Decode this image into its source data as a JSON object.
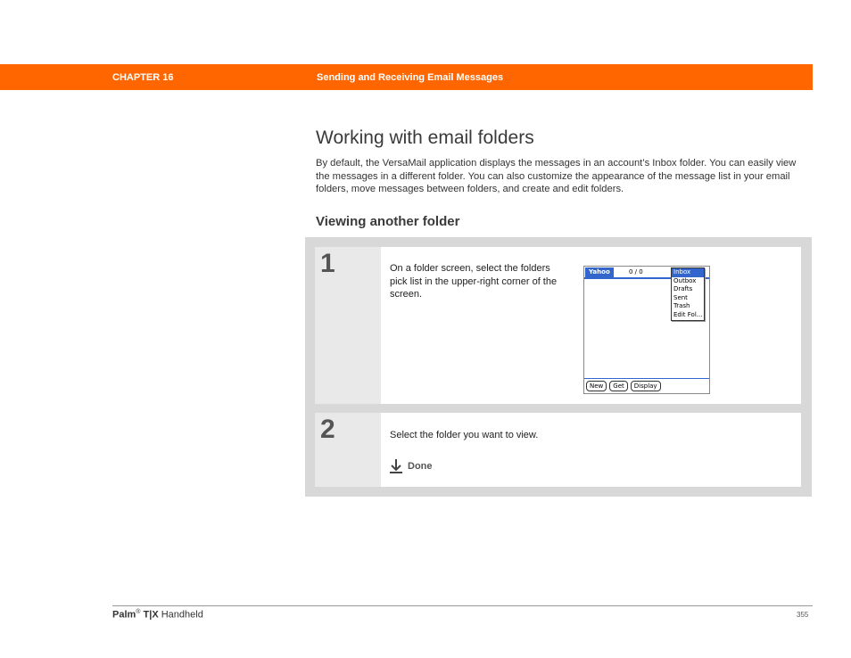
{
  "header": {
    "chapter": "CHAPTER 16",
    "title": "Sending and Receiving Email Messages",
    "color": "#ff6600"
  },
  "page_title": "Working with email folders",
  "intro": "By default, the VersaMail application displays the messages in an account’s Inbox folder. You can easily view the messages in a different folder. You can also customize the appearance of the message list in your email folders, move messages between folders, and create and edit folders.",
  "section_heading": "Viewing another folder",
  "steps": [
    {
      "number": "1",
      "text": "On a folder screen, select the folders pick list in the upper-right corner of the screen."
    },
    {
      "number": "2",
      "text": "Select the folder you want to view."
    }
  ],
  "done": {
    "label": "Done",
    "icon": "down-arrow-icon"
  },
  "palm_screen": {
    "account": "Yahoo",
    "count": "0 / 0",
    "folders": [
      "Inbox",
      "Outbox",
      "Drafts",
      "Sent",
      "Trash",
      "Edit Fol..."
    ],
    "selected_folder": "Inbox",
    "buttons": [
      "New",
      "Get",
      "Display"
    ],
    "accent": "#3366cc"
  },
  "footer": {
    "brand": "Palm",
    "reg": "®",
    "model": "T|X",
    "product": "Handheld",
    "page": "355"
  }
}
